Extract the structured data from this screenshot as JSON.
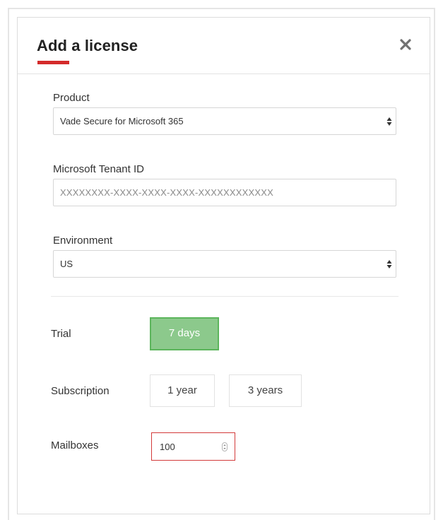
{
  "dialog": {
    "title": "Add a license",
    "accent_color": "#d42b2b",
    "close_icon": "close-icon"
  },
  "form": {
    "product": {
      "label": "Product",
      "selected": "Vade Secure for Microsoft 365"
    },
    "tenant": {
      "label": "Microsoft Tenant ID",
      "value": "",
      "placeholder": "XXXXXXXX-XXXX-XXXX-XXXX-XXXXXXXXXXXX"
    },
    "environment": {
      "label": "Environment",
      "selected": "US"
    },
    "trial": {
      "label": "Trial",
      "options": [
        {
          "label": "7 days",
          "selected": true
        }
      ]
    },
    "subscription": {
      "label": "Subscription",
      "options": [
        {
          "label": "1 year",
          "selected": false
        },
        {
          "label": "3 years",
          "selected": false
        }
      ]
    },
    "mailboxes": {
      "label": "Mailboxes",
      "value": "100"
    }
  },
  "colors": {
    "selected_bg": "#8cc98c",
    "selected_border": "#5cb55c",
    "error_border": "#d33a3a"
  }
}
